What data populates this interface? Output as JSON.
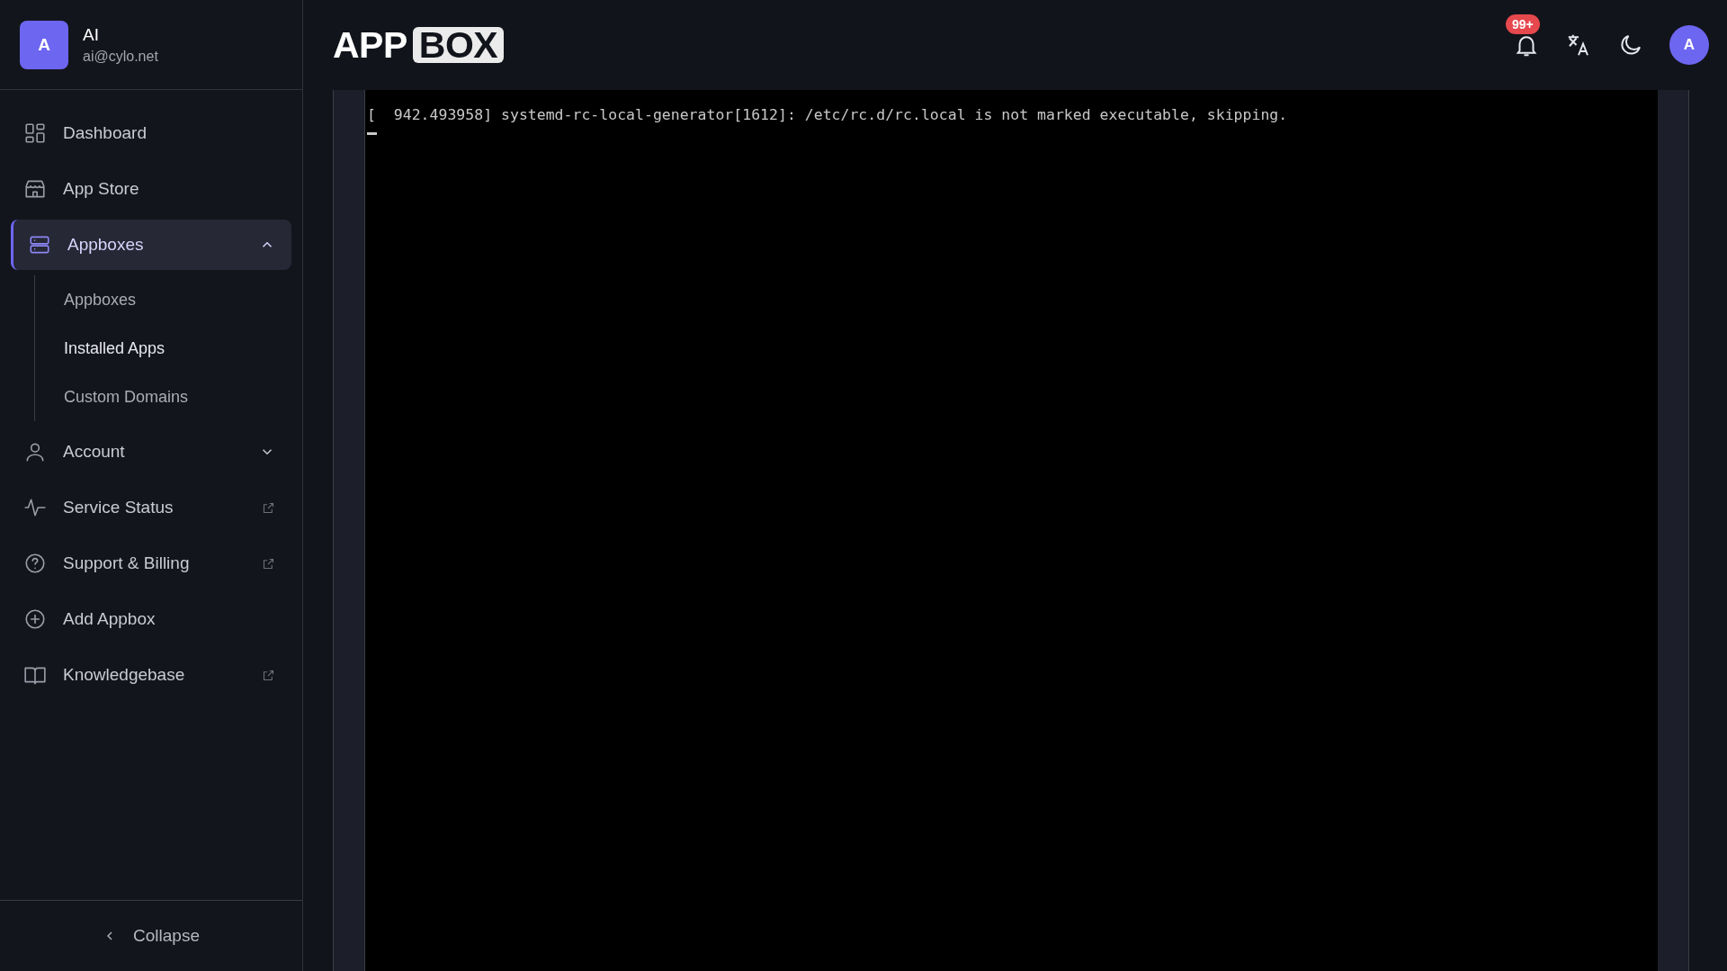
{
  "user": {
    "initial": "A",
    "name": "AI",
    "email": "ai@cylo.net"
  },
  "sidebar": {
    "items": [
      {
        "label": "Dashboard",
        "kind": "link",
        "selected": false
      },
      {
        "label": "App Store",
        "kind": "link",
        "selected": false
      },
      {
        "label": "Appboxes",
        "kind": "group",
        "selected": true,
        "expanded": true,
        "children": [
          {
            "label": "Appboxes",
            "selected": false
          },
          {
            "label": "Installed Apps",
            "selected": true
          },
          {
            "label": "Custom Domains",
            "selected": false
          }
        ]
      },
      {
        "label": "Account",
        "kind": "group",
        "selected": false,
        "expanded": false
      },
      {
        "label": "Service Status",
        "kind": "external",
        "selected": false
      },
      {
        "label": "Support & Billing",
        "kind": "external",
        "selected": false
      },
      {
        "label": "Add Appbox",
        "kind": "link",
        "selected": false
      },
      {
        "label": "Knowledgebase",
        "kind": "external",
        "selected": false
      }
    ],
    "collapse": "Collapse"
  },
  "header": {
    "logo_left": "APP",
    "logo_right": "BOX",
    "notification_badge": "99+",
    "avatar": "A"
  },
  "terminal": {
    "lines": [
      "[  942.493958] systemd-rc-local-generator[1612]: /etc/rc.d/rc.local is not marked executable, skipping."
    ]
  }
}
